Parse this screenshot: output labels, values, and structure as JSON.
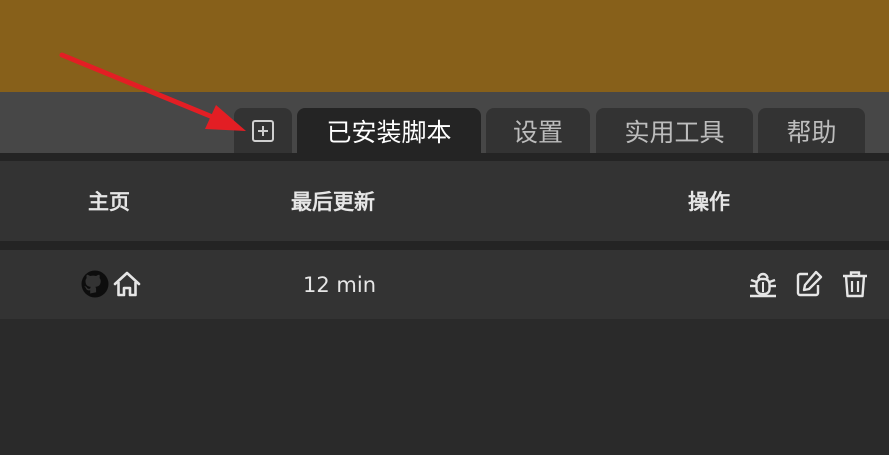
{
  "colors": {
    "banner": "#87601a",
    "tab_bar": "#474747",
    "tab_inactive": "#333333",
    "tab_active": "#242424",
    "table_bg": "#333333",
    "page_bg": "#2a2a2a",
    "annotation_arrow": "#e31e24",
    "text_primary": "#e6e6e6"
  },
  "tabs": [
    {
      "label": "",
      "icon": "plus-square-icon",
      "active": false
    },
    {
      "label": "已安装脚本",
      "active": true
    },
    {
      "label": "设置",
      "active": false
    },
    {
      "label": "实用工具",
      "active": false
    },
    {
      "label": "帮助",
      "active": false
    }
  ],
  "table": {
    "headers": {
      "home": "主页",
      "last_updated": "最后更新",
      "actions": "操作"
    },
    "rows": [
      {
        "home_icons": [
          "github-icon",
          "home-icon"
        ],
        "last_updated": "12 min",
        "action_icons": [
          "bug-icon",
          "edit-icon",
          "trash-icon"
        ]
      }
    ]
  },
  "annotation": {
    "type": "arrow",
    "points_to": "add-script-tab"
  }
}
